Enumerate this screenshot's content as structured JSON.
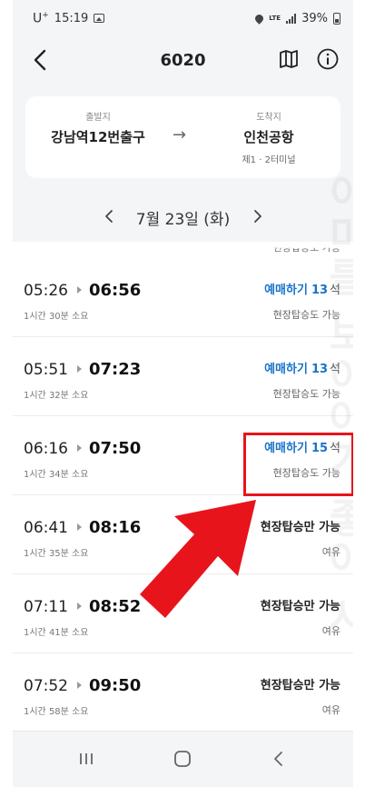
{
  "status_bar": {
    "carrier": "U",
    "carrier_sup": "+",
    "time": "15:19",
    "network": "LTE",
    "battery": "39%"
  },
  "header": {
    "title": "6020"
  },
  "route": {
    "departure_label": "출발지",
    "departure_name": "강남역12번출구",
    "arrow": "→",
    "arrival_label": "도착지",
    "arrival_name": "인천공항",
    "arrival_sub": "제1 · 2터미널"
  },
  "date": {
    "text": "7월 23일 (화)"
  },
  "schedule": [
    {
      "dep": "05:26",
      "arr": "06:56",
      "duration": "1시간 30분 소요",
      "type": "reserve",
      "reserve_label": "예매하기",
      "seats": "13",
      "seat_unit": "석",
      "sub": "현장탑승도 가능"
    },
    {
      "dep": "05:51",
      "arr": "07:23",
      "duration": "1시간 32분 소요",
      "type": "reserve",
      "reserve_label": "예매하기",
      "seats": "13",
      "seat_unit": "석",
      "sub": "현장탑승도 가능"
    },
    {
      "dep": "06:16",
      "arr": "07:50",
      "duration": "1시간 34분 소요",
      "type": "reserve",
      "reserve_label": "예매하기",
      "seats": "15",
      "seat_unit": "석",
      "sub": "현장탑승도 가능"
    },
    {
      "dep": "06:41",
      "arr": "08:16",
      "duration": "1시간 35분 소요",
      "type": "onsite",
      "main_label": "현장탑승만 가능",
      "sub": "여유"
    },
    {
      "dep": "07:11",
      "arr": "08:52",
      "duration": "1시간 41분 소요",
      "type": "onsite",
      "main_label": "현장탑승만 가능",
      "sub": "여유"
    },
    {
      "dep": "07:52",
      "arr": "09:50",
      "duration": "1시간 58분 소요",
      "type": "onsite",
      "main_label": "현장탑승만 가능",
      "sub": "여유"
    }
  ],
  "peek_text": "현장탑승도 가능",
  "watermark": "이미를 보이야기 좋아 시",
  "colors": {
    "accent_blue": "#1a73c9",
    "highlight_red": "#e8141c"
  }
}
